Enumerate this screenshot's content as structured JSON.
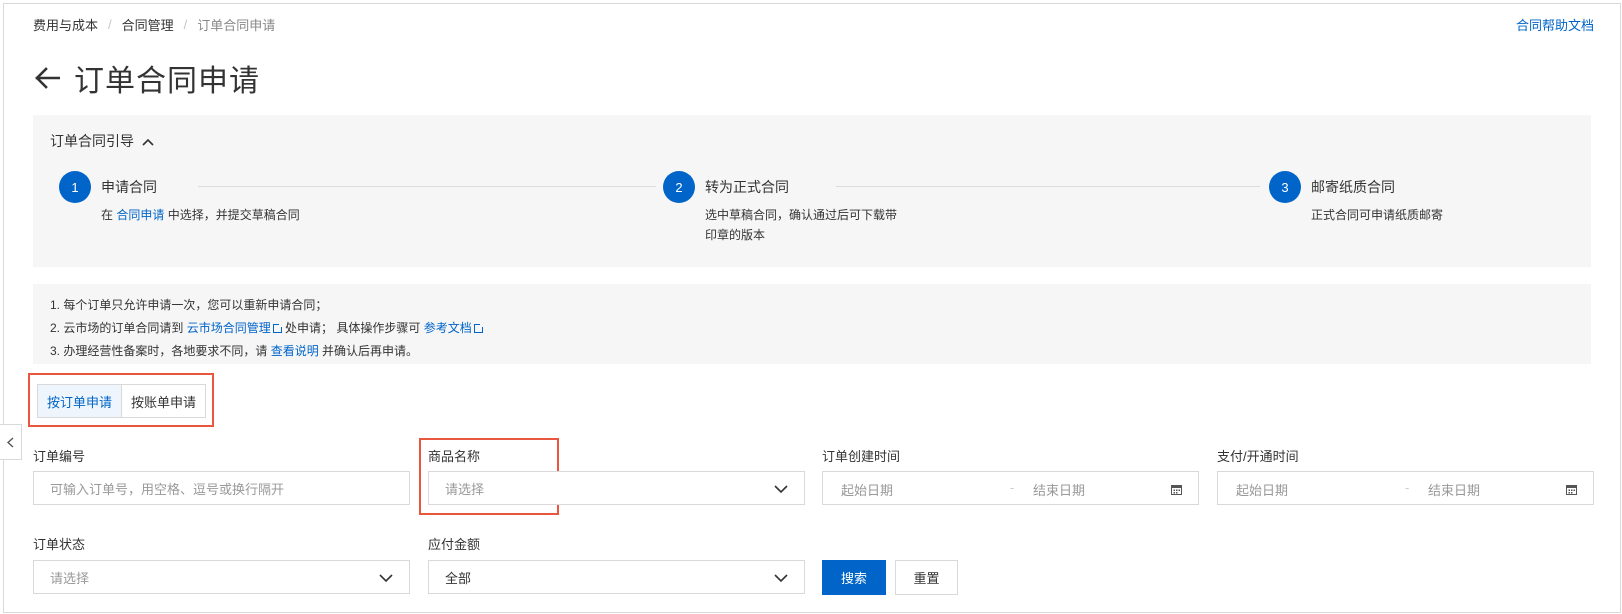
{
  "breadcrumb": {
    "items": [
      "费用与成本",
      "合同管理"
    ],
    "current": "订单合同申请",
    "separator": "/"
  },
  "help_link": "合同帮助文档",
  "page_title": "订单合同申请",
  "guide": {
    "title": "订单合同引导",
    "steps": [
      {
        "number": "1",
        "title": "申请合同",
        "desc_prefix": "在 ",
        "desc_link": "合同申请",
        "desc_suffix": " 中选择，并提交草稿合同"
      },
      {
        "number": "2",
        "title": "转为正式合同",
        "desc_line1": "选中草稿合同，确认通过后可下载带",
        "desc_line2": "印章的版本"
      },
      {
        "number": "3",
        "title": "邮寄纸质合同",
        "desc": "正式合同可申请纸质邮寄"
      }
    ]
  },
  "notice": {
    "line1": "1. 每个订单只允许申请一次，您可以重新申请合同；",
    "line2_prefix": "2. 云市场的订单合同请到 ",
    "line2_link1": "云市场合同管理",
    "line2_mid": " 处申请；  具体操作步骤可 ",
    "line2_link2": "参考文档",
    "line3_prefix": "3. 办理经营性备案时，各地要求不同，请 ",
    "line3_link": "查看说明",
    "line3_suffix": " 并确认后再申请。"
  },
  "tabs": [
    {
      "label": "按订单申请",
      "active": true
    },
    {
      "label": "按账单申请",
      "active": false
    }
  ],
  "filters": {
    "order_no": {
      "label": "订单编号",
      "placeholder": "可输入订单号，用空格、逗号或换行隔开"
    },
    "product_name": {
      "label": "商品名称",
      "placeholder": "请选择"
    },
    "create_time": {
      "label": "订单创建时间",
      "start": "起始日期",
      "end": "结束日期",
      "dash": "-"
    },
    "pay_time": {
      "label": "支付/开通时间",
      "start": "起始日期",
      "end": "结束日期",
      "dash": "-"
    },
    "status": {
      "label": "订单状态",
      "placeholder": "请选择"
    },
    "amount": {
      "label": "应付金额",
      "value": "全部"
    }
  },
  "buttons": {
    "search": "搜索",
    "reset": "重置"
  },
  "colors": {
    "primary": "#0064c8",
    "highlight": "#e8563f",
    "panel_bg": "#f6f6f6"
  }
}
